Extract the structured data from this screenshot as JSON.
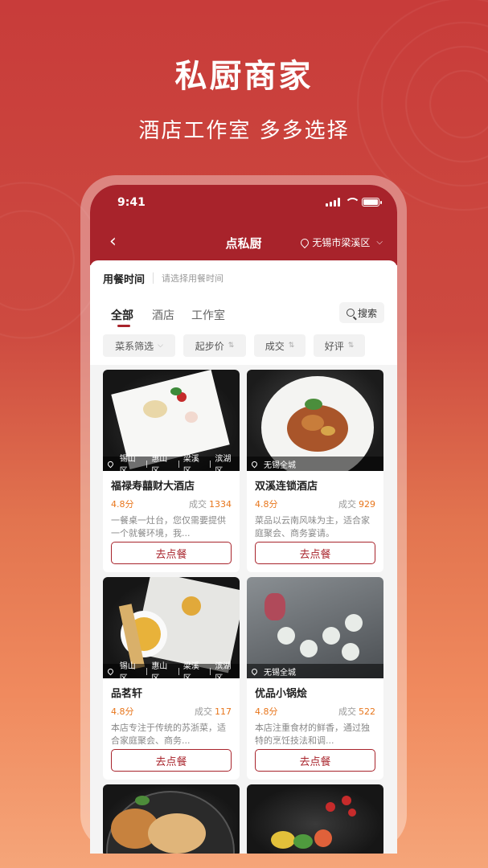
{
  "hero": {
    "title": "私厨商家",
    "subtitle": "酒店工作室  多多选择"
  },
  "status": {
    "time": "9:41"
  },
  "nav": {
    "back_icon": "chevron-left-icon",
    "title": "点私厨",
    "location": "无锡市梁溪区"
  },
  "meal_time": {
    "label": "用餐时间",
    "placeholder": "请选择用餐时间"
  },
  "tabs": [
    {
      "label": "全部",
      "active": true
    },
    {
      "label": "酒店"
    },
    {
      "label": "工作室"
    }
  ],
  "search": {
    "label": "搜索"
  },
  "filters": [
    {
      "label": "菜系筛选"
    },
    {
      "label": "起步价"
    },
    {
      "label": "成交"
    },
    {
      "label": "好评"
    }
  ],
  "cards": [
    {
      "areas": [
        "锡山区",
        "惠山区",
        "梁溪区",
        "滨湖区"
      ],
      "name": "福禄寿囍财大酒店",
      "score": "4.8分",
      "deal_label": "成交",
      "deal_count": "1334",
      "desc": "一餐桌一灶台，您仅需要提供一个就餐环境，我...",
      "button": "去点餐"
    },
    {
      "areas": [
        "无锡全城"
      ],
      "name": "双溪连锁酒店",
      "score": "4.8分",
      "deal_label": "成交",
      "deal_count": "929",
      "desc": "菜品以云南风味为主，适合家庭聚会、商务宴请。",
      "button": "去点餐"
    },
    {
      "areas": [
        "锡山区",
        "惠山区",
        "梁溪区",
        "滨湖区"
      ],
      "name": "品茗轩",
      "score": "4.8分",
      "deal_label": "成交",
      "deal_count": "117",
      "desc": "本店专注于传统的苏浙菜，适合家庭聚会、商务...",
      "button": "去点餐"
    },
    {
      "areas": [
        "无锡全城"
      ],
      "name": "优品小锅烩",
      "score": "4.8分",
      "deal_label": "成交",
      "deal_count": "522",
      "desc": "本店注重食材的鲜香，通过独特的烹饪技法和调...",
      "button": "去点餐"
    }
  ],
  "colors": {
    "brand": "#a8232b",
    "accent": "#e8761c"
  }
}
